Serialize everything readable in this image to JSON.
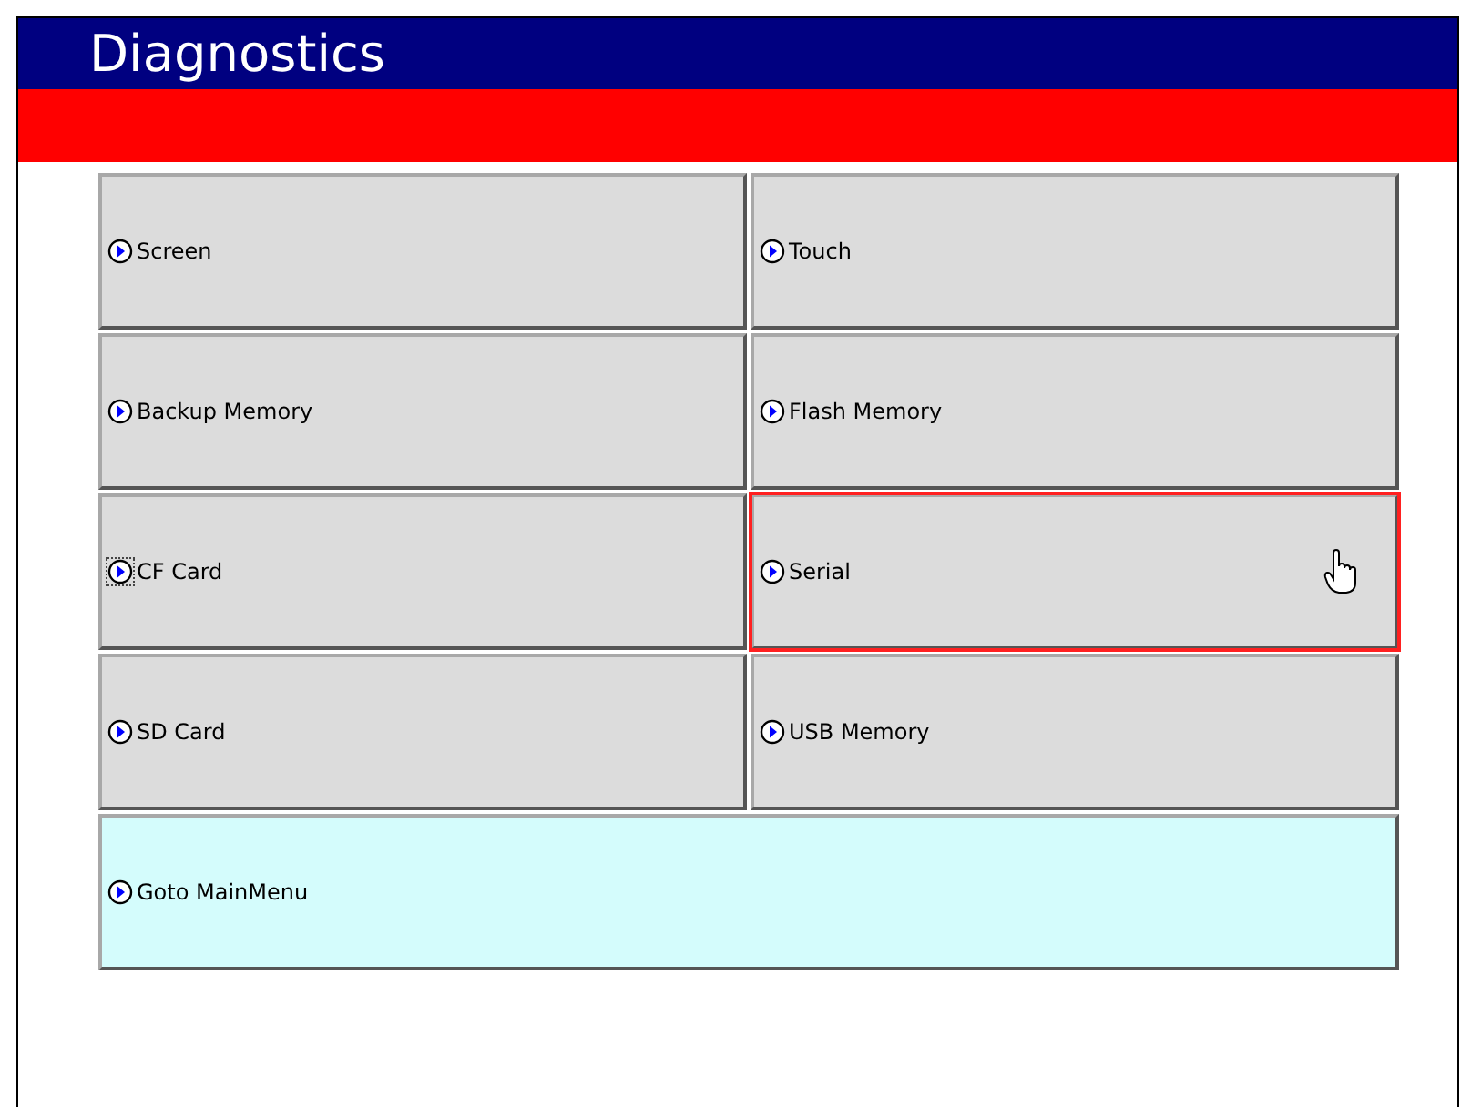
{
  "header": {
    "title": "Diagnostics"
  },
  "buttons": [
    {
      "label": "Screen",
      "kind": "normal",
      "selected": false,
      "focused": false
    },
    {
      "label": "Touch",
      "kind": "normal",
      "selected": false,
      "focused": false
    },
    {
      "label": "Backup Memory",
      "kind": "normal",
      "selected": false,
      "focused": false
    },
    {
      "label": "Flash Memory",
      "kind": "normal",
      "selected": false,
      "focused": false
    },
    {
      "label": "CF Card",
      "kind": "normal",
      "selected": false,
      "focused": true
    },
    {
      "label": "Serial",
      "kind": "normal",
      "selected": true,
      "focused": false
    },
    {
      "label": "SD Card",
      "kind": "normal",
      "selected": false,
      "focused": false
    },
    {
      "label": "USB Memory",
      "kind": "normal",
      "selected": false,
      "focused": false
    },
    {
      "label": "Goto MainMenu",
      "kind": "wide",
      "selected": false,
      "focused": false
    }
  ]
}
